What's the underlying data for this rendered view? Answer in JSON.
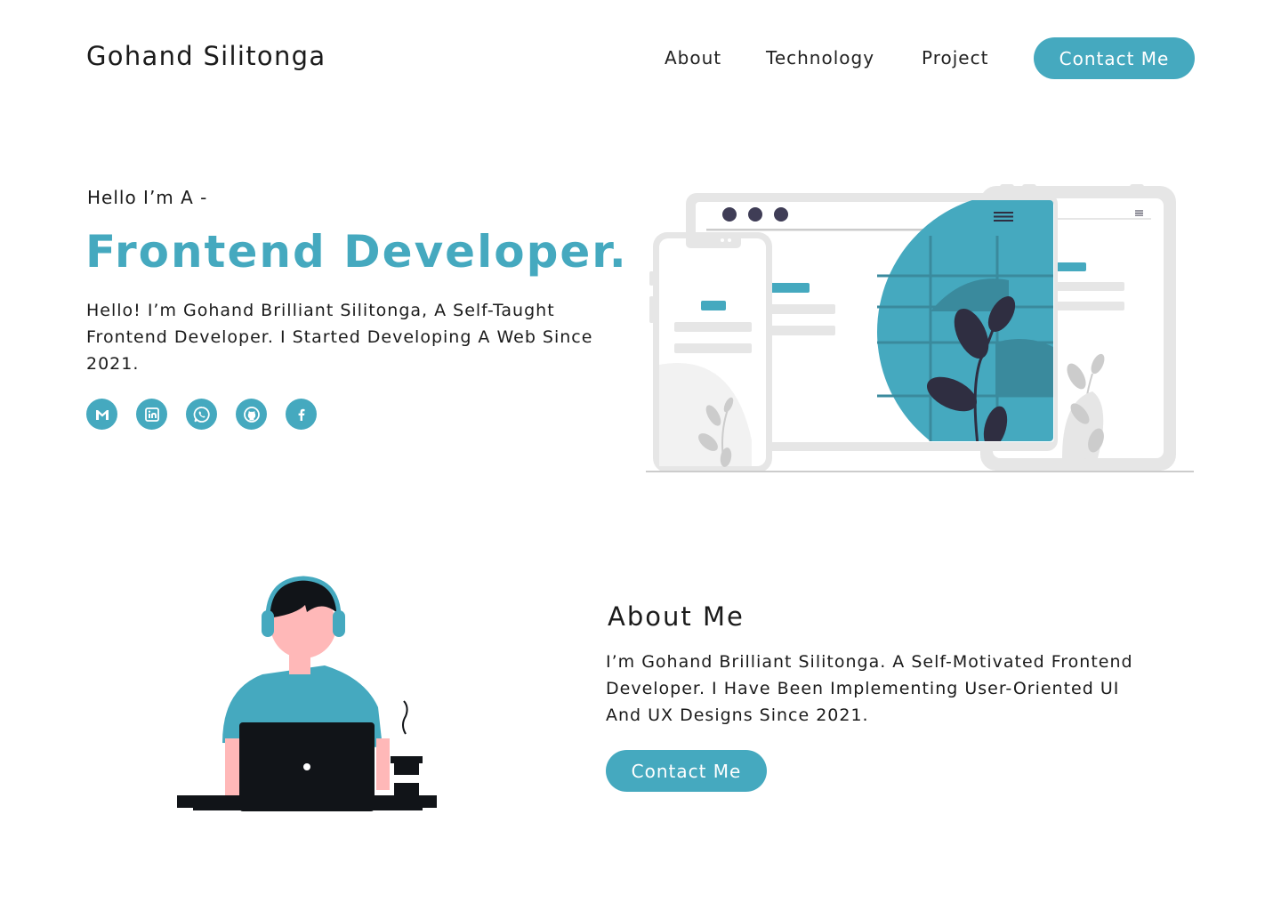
{
  "header": {
    "brand": "Gohand Silitonga",
    "nav": {
      "about": "About",
      "technology": "Technology",
      "project": "Project"
    },
    "contact_label": "Contact Me"
  },
  "hero": {
    "kicker": "Hello I’m A -",
    "title": "Frontend Developer.",
    "description": "Hello! I’m Gohand Brilliant Silitonga, A Self-Taught Frontend Developer. I Started Developing A Web Since 2021.",
    "socials": [
      {
        "icon": "gmail-icon"
      },
      {
        "icon": "linkedin-icon"
      },
      {
        "icon": "whatsapp-icon"
      },
      {
        "icon": "github-icon"
      },
      {
        "icon": "facebook-icon"
      }
    ]
  },
  "about": {
    "title": "About Me",
    "description": "I’m Gohand Brilliant Silitonga. A Self-Motivated Frontend Developer. I Have Been Implementing User-Oriented UI And UX Designs Since 2021.",
    "contact_label": "Contact Me"
  },
  "colors": {
    "accent": "#45a9bf",
    "text": "#1b1b1b",
    "illustration_gray": "#e6e6e6",
    "illustration_dark": "#2f2e41"
  }
}
